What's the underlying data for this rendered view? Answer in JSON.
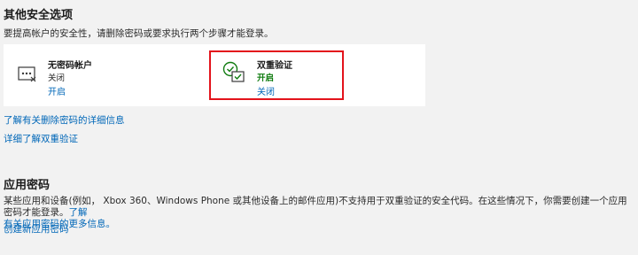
{
  "security": {
    "title": "其他安全选项",
    "description": "要提高帐户的安全性，请删除密码或要求执行两个步骤才能登录。",
    "cards": [
      {
        "title": "无密码帐户",
        "status": "关闭",
        "action": "开启",
        "icon": "password-dots-icon"
      },
      {
        "title": "双重验证",
        "status": "开启",
        "action": "关闭",
        "icon": "two-step-verification-icon"
      }
    ],
    "links": [
      "了解有关删除密码的详细信息",
      "详细了解双重验证"
    ]
  },
  "app_passwords": {
    "title": "应用密码",
    "description_line1": "某些应用和设备(例如， Xbox 360、Windows Phone 或其他设备上的邮件应用)不支持用于双重验证的安全代码。在这些情况下，你需要创建一个应用密码才能登录。",
    "description_link_part1": "了解",
    "description_link_part2": "有关应用密码的更多信息。",
    "create_link": "创建新应用密码"
  },
  "colors": {
    "link": "#0067b8",
    "status_on": "#107c10",
    "highlight": "#e3131b",
    "icon_accent": "#107c10"
  }
}
